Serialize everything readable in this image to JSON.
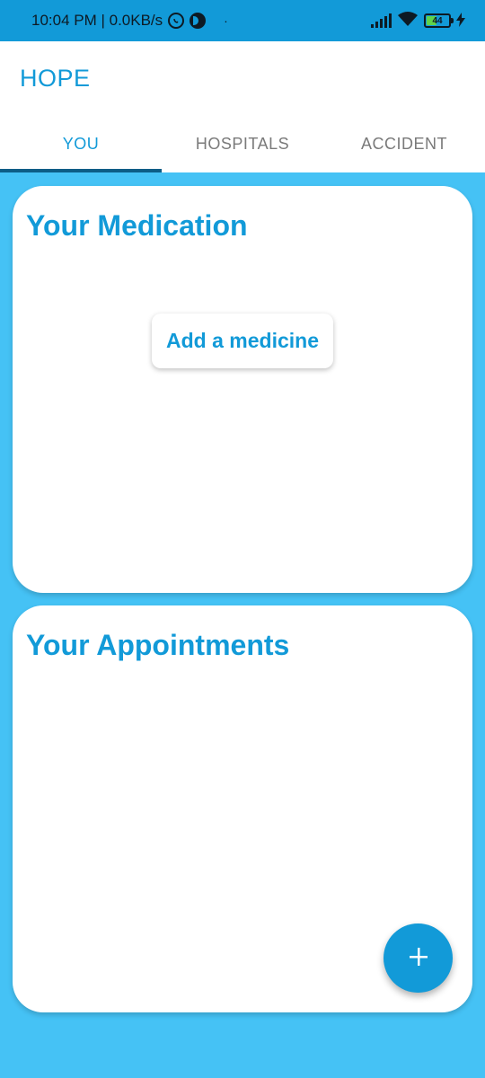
{
  "status_bar": {
    "time_speed": "10:04 PM | 0.0KB/s",
    "dot": "·",
    "battery_level": "44",
    "icons": [
      "whatsapp-icon",
      "data-saver-icon",
      "signal-icon",
      "wifi-icon",
      "battery-icon",
      "charging-icon"
    ]
  },
  "app": {
    "title": "HOPE",
    "primary_color": "#129ad8",
    "background_color": "#45c2f5"
  },
  "tabs": [
    {
      "label": "YOU",
      "active": true
    },
    {
      "label": "HOSPITALS",
      "active": false
    },
    {
      "label": "ACCIDENT",
      "active": false
    }
  ],
  "medication": {
    "title": "Your Medication",
    "add_button_label": "Add a medicine"
  },
  "appointments": {
    "title": "Your Appointments"
  },
  "fab": {
    "icon": "plus-icon"
  }
}
